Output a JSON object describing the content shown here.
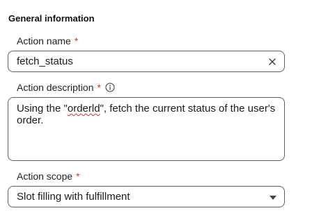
{
  "section": {
    "title": "General information"
  },
  "action_name": {
    "label": "Action name",
    "required_mark": "*",
    "value": "fetch_status",
    "clear_icon": "close-icon"
  },
  "action_description": {
    "label": "Action description",
    "required_mark": "*",
    "info_icon": "info-icon",
    "text_before": "Using the \"",
    "text_misspelled": "orderld",
    "text_after": "\", fetch the current status of the user's order."
  },
  "action_scope": {
    "label": "Action scope",
    "required_mark": "*",
    "selected": "Slot filling with fulfillment",
    "dropdown_icon": "chevron-down-icon"
  },
  "colors": {
    "required": "#d0342c",
    "border": "#5f5f5f",
    "text": "#1b1b1b"
  }
}
